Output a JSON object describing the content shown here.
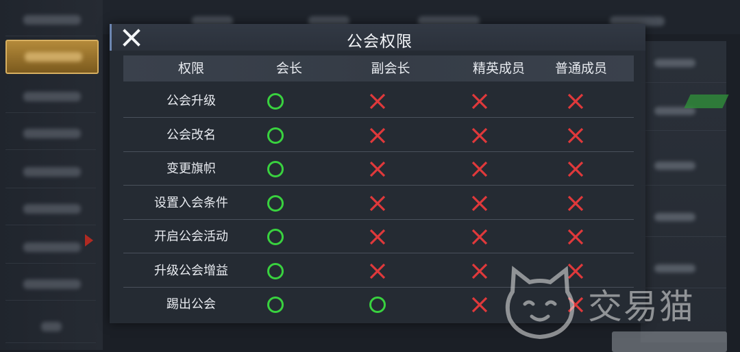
{
  "dialog": {
    "title": "公会权限",
    "close_icon": "close-icon"
  },
  "table": {
    "headers": [
      "权限",
      "会长",
      "副会长",
      "精英成员",
      "普通成员"
    ],
    "rows": [
      {
        "label": "公会升级",
        "cells": [
          "allowed",
          "denied",
          "denied",
          "denied"
        ]
      },
      {
        "label": "公会改名",
        "cells": [
          "allowed",
          "denied",
          "denied",
          "denied"
        ]
      },
      {
        "label": "变更旗帜",
        "cells": [
          "allowed",
          "denied",
          "denied",
          "denied"
        ]
      },
      {
        "label": "设置入会条件",
        "cells": [
          "allowed",
          "denied",
          "denied",
          "denied"
        ]
      },
      {
        "label": "开启公会活动",
        "cells": [
          "allowed",
          "denied",
          "denied",
          "denied"
        ]
      },
      {
        "label": "升级公会增益",
        "cells": [
          "allowed",
          "denied",
          "denied",
          "denied"
        ]
      },
      {
        "label": "踢出公会",
        "cells": [
          "allowed",
          "allowed",
          "denied",
          "denied"
        ]
      }
    ]
  },
  "icons": {
    "allowed": "circle-check-icon",
    "denied": "red-x-icon"
  },
  "colors": {
    "allowed": "#39d23f",
    "denied": "#e0393b",
    "panel_bg": "#262b34",
    "header_accent": "#6d87b2"
  },
  "watermark": {
    "text": "交易猫"
  }
}
